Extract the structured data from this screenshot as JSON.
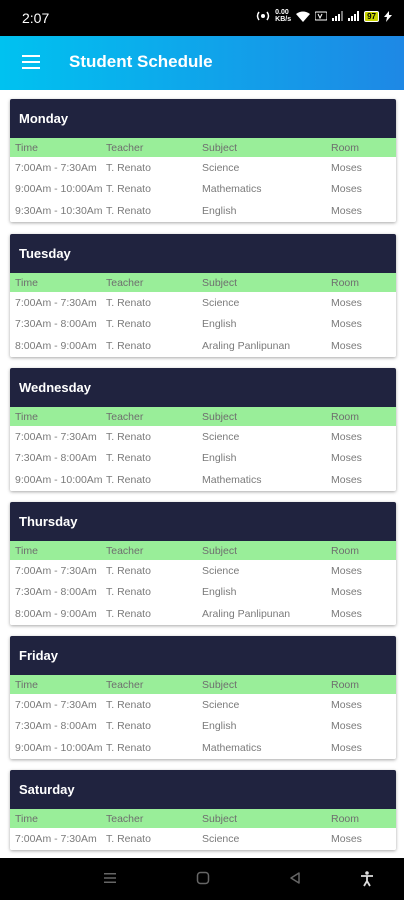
{
  "status_bar": {
    "time": "2:07",
    "speed": "0.00\nKB/s",
    "battery": "97"
  },
  "app_bar": {
    "title": "Student Schedule",
    "menu_icon": "hamburger-menu-icon"
  },
  "columns": [
    "Time",
    "Teacher",
    "Subject",
    "Room"
  ],
  "colors": {
    "app_bar_start": "#00c2f0",
    "app_bar_end": "#1e88e5",
    "day_header": "#20233f",
    "column_header": "#99ee99"
  },
  "days": [
    {
      "name": "Monday",
      "rows": [
        [
          "7:00Am - 7:30Am",
          "T. Renato",
          "Science",
          "Moses"
        ],
        [
          "9:00Am - 10:00Am",
          "T. Renato",
          "Mathematics",
          "Moses"
        ],
        [
          "9:30Am - 10:30Am",
          "T. Renato",
          "English",
          "Moses"
        ]
      ]
    },
    {
      "name": "Tuesday",
      "rows": [
        [
          "7:00Am - 7:30Am",
          "T. Renato",
          "Science",
          "Moses"
        ],
        [
          "7:30Am - 8:00Am",
          "T. Renato",
          "English",
          "Moses"
        ],
        [
          "8:00Am - 9:00Am",
          "T. Renato",
          "Araling Panlipunan",
          "Moses"
        ]
      ]
    },
    {
      "name": "Wednesday",
      "rows": [
        [
          "7:00Am - 7:30Am",
          "T. Renato",
          "Science",
          "Moses"
        ],
        [
          "7:30Am - 8:00Am",
          "T. Renato",
          "English",
          "Moses"
        ],
        [
          "9:00Am - 10:00Am",
          "T. Renato",
          "Mathematics",
          "Moses"
        ]
      ]
    },
    {
      "name": "Thursday",
      "rows": [
        [
          "7:00Am - 7:30Am",
          "T. Renato",
          "Science",
          "Moses"
        ],
        [
          "7:30Am - 8:00Am",
          "T. Renato",
          "English",
          "Moses"
        ],
        [
          "8:00Am - 9:00Am",
          "T. Renato",
          "Araling Panlipunan",
          "Moses"
        ]
      ]
    },
    {
      "name": "Friday",
      "rows": [
        [
          "7:00Am - 7:30Am",
          "T. Renato",
          "Science",
          "Moses"
        ],
        [
          "7:30Am - 8:00Am",
          "T. Renato",
          "English",
          "Moses"
        ],
        [
          "9:00Am - 10:00Am",
          "T. Renato",
          "Mathematics",
          "Moses"
        ]
      ]
    },
    {
      "name": "Saturday",
      "rows": [
        [
          "7:00Am - 7:30Am",
          "T. Renato",
          "Science",
          "Moses"
        ]
      ]
    }
  ],
  "nav_bar": {
    "icons": [
      "recents-icon",
      "home-icon",
      "back-icon",
      "accessibility-icon"
    ]
  }
}
